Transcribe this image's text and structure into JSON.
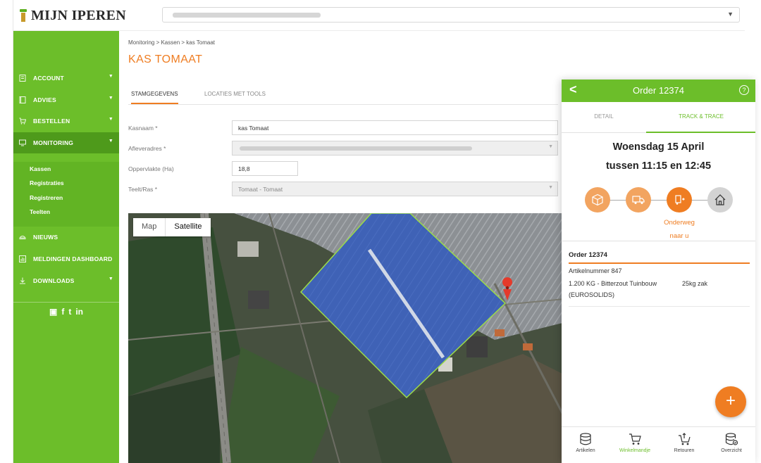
{
  "app": {
    "logo_text": "MIJN IPEREN"
  },
  "client_select": {
    "value": ""
  },
  "sidebar": {
    "items": [
      {
        "label": "ACCOUNT",
        "icon": "user-icon",
        "has_sub": true
      },
      {
        "label": "ADVIES",
        "icon": "book-icon",
        "has_sub": true
      },
      {
        "label": "BESTELLEN",
        "icon": "cart-icon",
        "has_sub": true
      },
      {
        "label": "MONITORING",
        "icon": "monitor-icon",
        "has_sub": true,
        "active": true
      },
      {
        "label": "NIEUWS",
        "icon": "news-icon",
        "has_sub": false
      },
      {
        "label": "MELDINGEN DASHBOARD",
        "icon": "dashboard-icon",
        "has_sub": false
      },
      {
        "label": "DOWNLOADS",
        "icon": "download-icon",
        "has_sub": true
      }
    ],
    "submenu": [
      "Kassen",
      "Registraties",
      "Registreren",
      "Teelten"
    ],
    "socials": [
      "youtube-icon",
      "facebook-icon",
      "twitter-icon",
      "linkedin-icon"
    ]
  },
  "breadcrumb": "Monitoring > Kassen > kas Tomaat",
  "page_title": "KAS TOMAAT",
  "tabs": [
    "STAMGEGEVENS",
    "LOCATIES MET TOOLS"
  ],
  "form": {
    "kasnaam": {
      "label": "Kasnaam *",
      "value": "kas Tomaat"
    },
    "afleveradres": {
      "label": "Afleveradres *",
      "value": ""
    },
    "oppervlakte": {
      "label": "Oppervlakte (Ha)",
      "value": "18,8"
    },
    "teelt": {
      "label": "Teelt/Ras *",
      "value": "Tomaat - Tomaat"
    }
  },
  "map": {
    "toggle": [
      "Map",
      "Satellite"
    ],
    "selected": "Satellite"
  },
  "phone": {
    "title": "Order 12374",
    "tabs": [
      "DETAIL",
      "TRACK & TRACE"
    ],
    "active_tab": "TRACK & TRACE",
    "date_line": "Woensdag 15 April",
    "time_line": "tussen 11:15 en 12:45",
    "status_label_1": "Onderweg",
    "status_label_2": "naar u",
    "order_no": "Order 12374",
    "article": "Artikelnummer 847",
    "line_desc_1": "1.200 KG - Bitterzout Tuinbouw",
    "line_qty": "25kg zak",
    "line_desc_2": "(EUROSOLIDS)",
    "fab": "+",
    "nav": [
      "Artikelen",
      "Winkelmandje",
      "Retouren",
      "Overzicht"
    ],
    "active_nav": "Winkelmandje"
  },
  "colors": {
    "brand_green": "#6cbe2a",
    "accent_orange": "#ef7d22"
  }
}
